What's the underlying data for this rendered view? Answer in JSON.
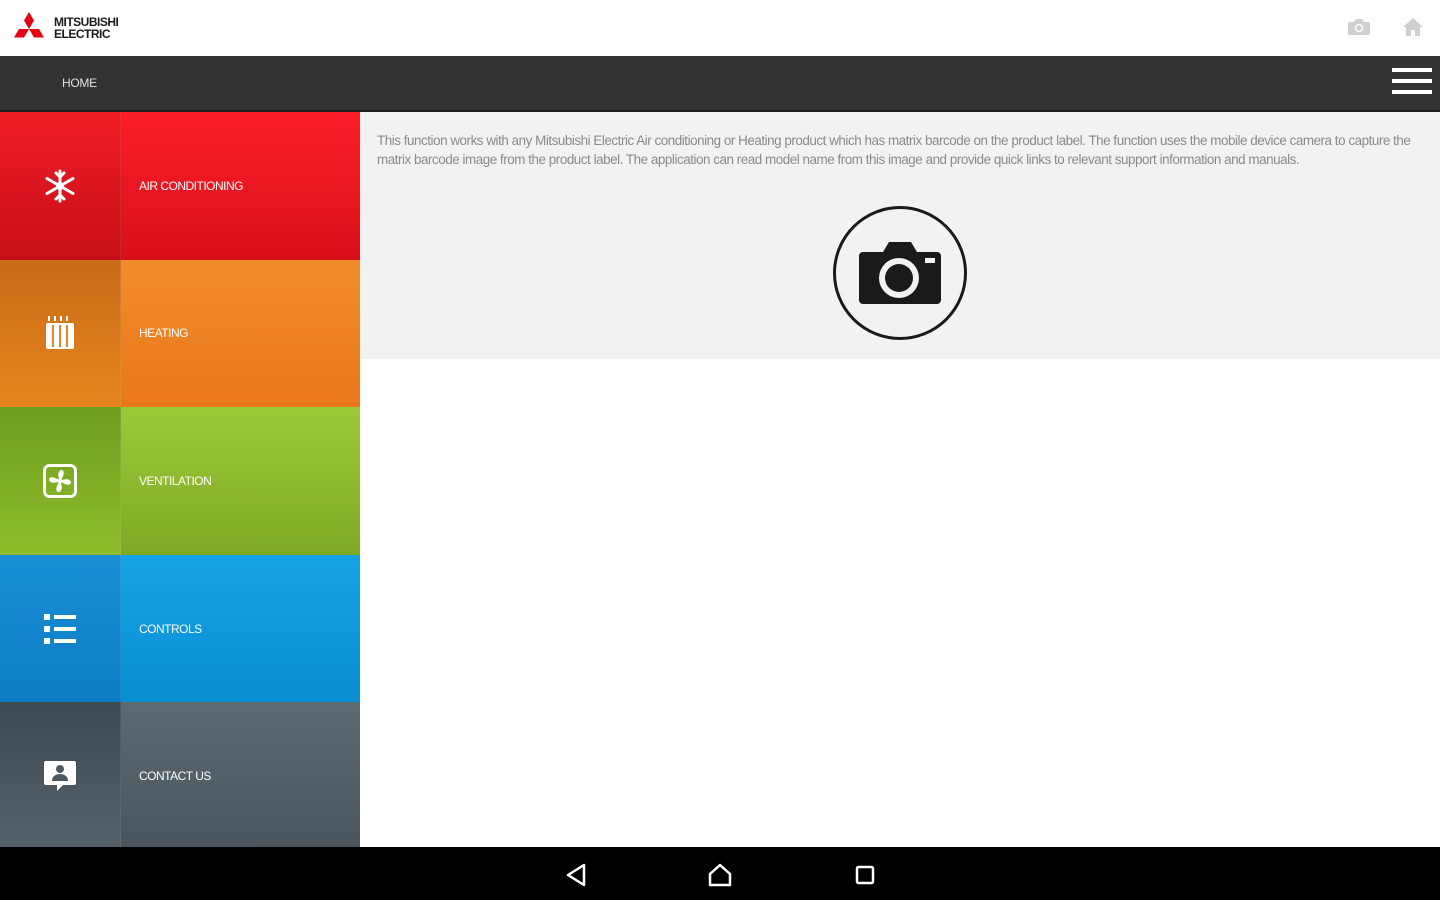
{
  "header": {
    "brand_line1": "MITSUBISHI",
    "brand_line2": "ELECTRIC",
    "brand_color": "#e60012",
    "icons": [
      "camera-icon",
      "home-icon"
    ]
  },
  "nav": {
    "home_label": "HOME",
    "menu_icon": "hamburger-menu-icon"
  },
  "sidebar": {
    "items": [
      {
        "label": "AIR CONDITIONING",
        "icon": "snowflake-icon",
        "color": "#ee1c25"
      },
      {
        "label": "HEATING",
        "icon": "radiator-icon",
        "color": "#f28d2b"
      },
      {
        "label": "VENTILATION",
        "icon": "fan-icon",
        "color": "#8dbd2c"
      },
      {
        "label": "CONTROLS",
        "icon": "list-icon",
        "color": "#16a3e6"
      },
      {
        "label": "CONTACT US",
        "icon": "contact-chat-icon",
        "color": "#56626a"
      }
    ]
  },
  "main": {
    "description": "This function works with any Mitsubishi Electric Air conditioning or Heating product which has matrix barcode on the product label. The function uses the mobile device camera to capture the matrix barcode image from the product label. The application can read model name from this image and provide quick links to relevant support information and manuals.",
    "scan_icon": "camera-icon"
  },
  "system_nav": {
    "buttons": [
      "back-icon",
      "home-icon",
      "recents-icon"
    ]
  }
}
